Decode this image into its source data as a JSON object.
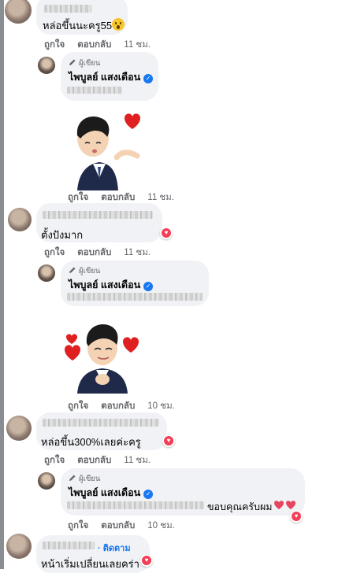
{
  "colors": {
    "reaction_love": "#f33e58",
    "link_blue": "#1877f2",
    "bubble_bg": "#f0f2f5",
    "muted": "#65676b"
  },
  "labels": {
    "like": "ถูกใจ",
    "reply": "ตอบกลับ",
    "author_tag": "ผู้เขียน",
    "author_name": "ไพบูลย์ แสงเดือน",
    "follow": "· ติดตาม",
    "verified_glyph": "✓"
  },
  "comments": [
    {
      "text": "หล่อขึ้นนะครู55",
      "emoji": "hushed-face-emoji",
      "time": "11 ชม."
    },
    {
      "sticker": "blowing-kiss-sticker",
      "time": "11 ชม."
    },
    {
      "text": "ตั้งปังมาก",
      "reaction": "love",
      "time": "11 ชม."
    },
    {
      "sticker": "hearts-sticker",
      "time": "10 ชม."
    },
    {
      "text": "หล่อขึ้น300%เลยค่ะครู",
      "reaction": "love",
      "time": "11 ชม."
    },
    {
      "text_visible": "ขอบคุณครับผม",
      "emoji": "heart-emojis",
      "reaction": "love",
      "time": "10 ชม."
    },
    {
      "text": "หน้าเริ่มเปลี่ยนเลยคร่า",
      "reaction": "love"
    }
  ]
}
